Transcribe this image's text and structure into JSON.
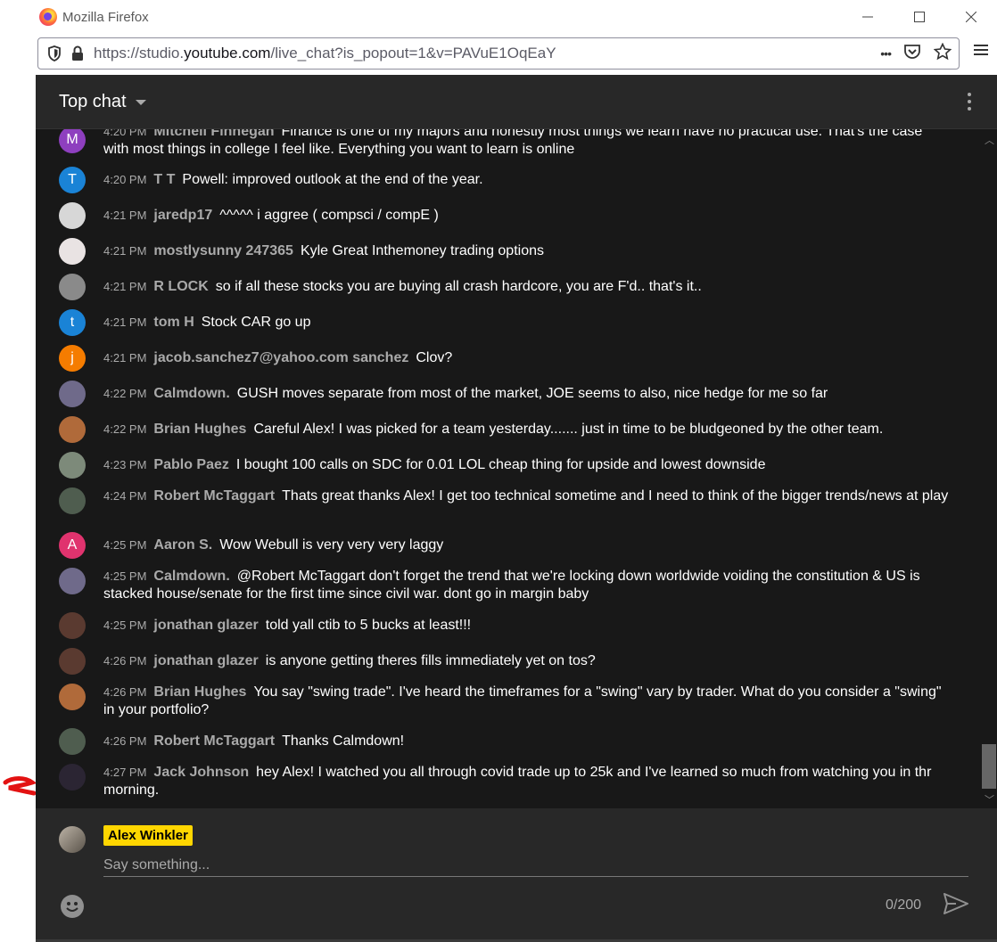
{
  "window": {
    "title": "Mozilla Firefox",
    "controls": [
      "—",
      "☐",
      "✕"
    ]
  },
  "urlbar": {
    "url_prefix": "https://studio.",
    "url_domain": "youtube.com",
    "url_suffix": "/live_chat?is_popout=1&v=PAVuE1OqEaY",
    "more": "•••"
  },
  "chat": {
    "header_label": "Top chat",
    "messages": [
      {
        "time": "4:20 PM",
        "author": "Mitchell Finnegan",
        "text": "Finance is one of my majors and honestly most things we learn have no practical use. That's the case with most things in college I feel like. Everything you want to learn is online",
        "avatar": "M",
        "avatar_color": "#8e3fbf"
      },
      {
        "time": "4:20 PM",
        "author": "T T",
        "text": "Powell: improved outlook at the end of the year.",
        "avatar": "T",
        "avatar_color": "#1a83d6"
      },
      {
        "time": "4:21 PM",
        "author": "jaredp17",
        "text": "^^^^^ i aggree ( compsci / compE )",
        "avatar": "",
        "avatar_color": "#d7d7d7"
      },
      {
        "time": "4:21 PM",
        "author": "mostlysunny 247365",
        "text": "Kyle Great Inthemoney trading options",
        "avatar": "",
        "avatar_color": "#e9e3e3"
      },
      {
        "time": "4:21 PM",
        "author": "R LOCK",
        "text": "so if all these stocks you are buying all crash hardcore, you are F'd.. that's it..",
        "avatar": "",
        "avatar_color": "#8a8a8a"
      },
      {
        "time": "4:21 PM",
        "author": "tom H",
        "text": "Stock CAR go up",
        "avatar": "t",
        "avatar_color": "#1a83d6"
      },
      {
        "time": "4:21 PM",
        "author": "jacob.sanchez7@yahoo.com sanchez",
        "text": "Clov?",
        "avatar": "j",
        "avatar_color": "#f57c00"
      },
      {
        "time": "4:22 PM",
        "author": "Calmdown.",
        "text": "GUSH moves separate from most of the market, JOE seems to also, nice hedge for me so far",
        "avatar": "",
        "avatar_color": "#6f6a8a"
      },
      {
        "time": "4:22 PM",
        "author": "Brian Hughes",
        "text": "Careful Alex! I was picked for a team yesterday....... just in time to be bludgeoned by the other team.",
        "avatar": "",
        "avatar_color": "#b06a3a"
      },
      {
        "time": "4:23 PM",
        "author": "Pablo Paez",
        "text": "I bought 100 calls on SDC for 0.01 LOL cheap thing for upside and lowest downside",
        "avatar": "",
        "avatar_color": "#7d8a7a"
      },
      {
        "time": "4:24 PM",
        "author": "Robert McTaggart",
        "text": "Thats great thanks Alex! I get too technical sometime and I need to think of the bigger trends/news at play",
        "avatar": "",
        "avatar_color": "#4f5d4f"
      },
      {
        "time": "4:25 PM",
        "author": "Aaron S.",
        "text": "Wow Webull is very very very laggy",
        "avatar": "A",
        "avatar_color": "#e0336e"
      },
      {
        "time": "4:25 PM",
        "author": "Calmdown.",
        "text": "@Robert McTaggart don't forget the trend that we're locking down worldwide voiding the constitution & US is stacked house/senate for the first time since civil war. dont go in margin baby",
        "avatar": "",
        "avatar_color": "#6f6a8a"
      },
      {
        "time": "4:25 PM",
        "author": "jonathan glazer",
        "text": "told yall ctib to 5 bucks at least!!!",
        "avatar": "",
        "avatar_color": "#5a3a30"
      },
      {
        "time": "4:26 PM",
        "author": "jonathan glazer",
        "text": "is anyone getting theres fills immediately yet on tos?",
        "avatar": "",
        "avatar_color": "#5a3a30"
      },
      {
        "time": "4:26 PM",
        "author": "Brian Hughes",
        "text": "You say \"swing trade\". I've heard the timeframes for a \"swing\" vary by trader. What do you consider a \"swing\" in your portfolio?",
        "avatar": "",
        "avatar_color": "#b06a3a"
      },
      {
        "time": "4:26 PM",
        "author": "Robert McTaggart",
        "text": "Thanks Calmdown!",
        "avatar": "",
        "avatar_color": "#4f5d4f"
      },
      {
        "time": "4:27 PM",
        "author": "Jack Johnson",
        "text": "hey Alex! I watched you all through covid trade up to 25k and I've learned so much from watching you in thr morning.",
        "avatar": "",
        "avatar_color": "#2b2533"
      }
    ]
  },
  "composer": {
    "user_name": "Alex Winkler",
    "placeholder": "Say something...",
    "char_count": "0/200"
  }
}
